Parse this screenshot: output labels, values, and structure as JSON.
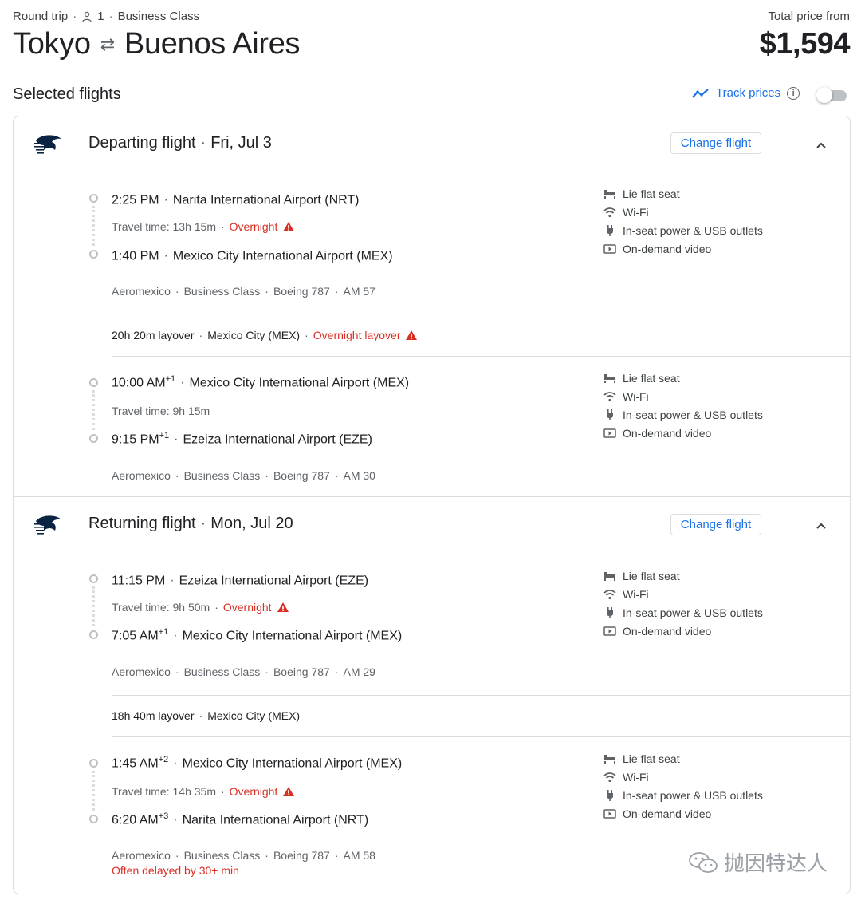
{
  "header": {
    "trip_type": "Round trip",
    "passengers": "1",
    "cabin": "Business Class",
    "origin": "Tokyo",
    "swap_glyph": "⇄",
    "destination": "Buenos Aires",
    "price_label": "Total price from",
    "price": "$1,594"
  },
  "selected_label": "Selected flights",
  "track_prices": {
    "label": "Track prices",
    "info": "i",
    "enabled": false
  },
  "departing": {
    "title": "Departing flight",
    "date": "Fri, Jul 3",
    "change_label": "Change flight",
    "segments": [
      {
        "dep_time": "2:25 PM",
        "dep_sup": "",
        "dep_airport": "Narita International Airport (NRT)",
        "travel": "Travel time: 13h 15m",
        "overnight": "Overnight",
        "arr_time": "1:40 PM",
        "arr_sup": "",
        "arr_airport": "Mexico City International Airport (MEX)",
        "airline": "Aeromexico",
        "cabin": "Business Class",
        "aircraft": "Boeing 787",
        "flight": "AM 57",
        "amenities": [
          "Lie flat seat",
          "Wi-Fi",
          "In-seat power & USB outlets",
          "On-demand video"
        ]
      },
      {
        "dep_time": "10:00 AM",
        "dep_sup": "+1",
        "dep_airport": "Mexico City International Airport (MEX)",
        "travel": "Travel time: 9h 15m",
        "overnight": "",
        "arr_time": "9:15 PM",
        "arr_sup": "+1",
        "arr_airport": "Ezeiza International Airport (EZE)",
        "airline": "Aeromexico",
        "cabin": "Business Class",
        "aircraft": "Boeing 787",
        "flight": "AM 30",
        "amenities": [
          "Lie flat seat",
          "Wi-Fi",
          "In-seat power & USB outlets",
          "On-demand video"
        ]
      }
    ],
    "layover": {
      "duration": "20h 20m layover",
      "city": "Mexico City (MEX)",
      "note": "Overnight layover"
    }
  },
  "returning": {
    "title": "Returning flight",
    "date": "Mon, Jul 20",
    "change_label": "Change flight",
    "segments": [
      {
        "dep_time": "11:15 PM",
        "dep_sup": "",
        "dep_airport": "Ezeiza International Airport (EZE)",
        "travel": "Travel time: 9h 50m",
        "overnight": "Overnight",
        "arr_time": "7:05 AM",
        "arr_sup": "+1",
        "arr_airport": "Mexico City International Airport (MEX)",
        "airline": "Aeromexico",
        "cabin": "Business Class",
        "aircraft": "Boeing 787",
        "flight": "AM 29",
        "amenities": [
          "Lie flat seat",
          "Wi-Fi",
          "In-seat power & USB outlets",
          "On-demand video"
        ]
      },
      {
        "dep_time": "1:45 AM",
        "dep_sup": "+2",
        "dep_airport": "Mexico City International Airport (MEX)",
        "travel": "Travel time: 14h 35m",
        "overnight": "Overnight",
        "arr_time": "6:20 AM",
        "arr_sup": "+3",
        "arr_airport": "Narita International Airport (NRT)",
        "airline": "Aeromexico",
        "cabin": "Business Class",
        "aircraft": "Boeing 787",
        "flight": "AM 58",
        "delay": "Often delayed by 30+ min",
        "amenities": [
          "Lie flat seat",
          "Wi-Fi",
          "In-seat power & USB outlets",
          "On-demand video"
        ]
      }
    ],
    "layover": {
      "duration": "18h 40m layover",
      "city": "Mexico City (MEX)",
      "note": ""
    }
  },
  "watermark": "抛因特达人",
  "colors": {
    "accent": "#1a73e8",
    "warning": "#d93025",
    "logo": "#0b2343"
  }
}
